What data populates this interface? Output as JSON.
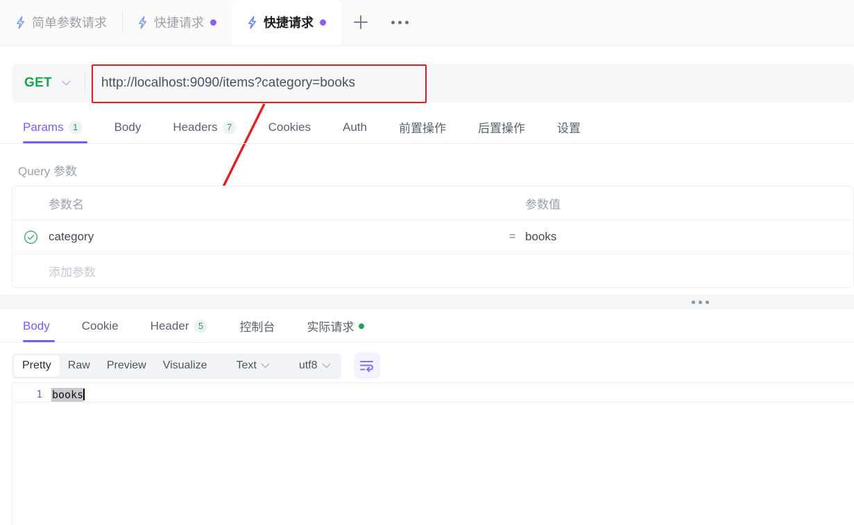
{
  "tabbar": {
    "tabs": [
      {
        "label": "简单参数请求",
        "icon": "lightning-icon",
        "active": false,
        "modified": false
      },
      {
        "label": "快捷请求",
        "icon": "lightning-icon",
        "active": false,
        "modified": true
      },
      {
        "label": "快捷请求",
        "icon": "lightning-icon",
        "active": true,
        "modified": true
      }
    ],
    "add_label": "+",
    "more_label": "•••"
  },
  "request": {
    "method": "GET",
    "url": "http://localhost:9090/items?category=books",
    "tabs": [
      {
        "label": "Params",
        "badge": "1",
        "active": true
      },
      {
        "label": "Body",
        "badge": "",
        "active": false
      },
      {
        "label": "Headers",
        "badge": "7",
        "active": false
      },
      {
        "label": "Cookies",
        "badge": "",
        "active": false
      },
      {
        "label": "Auth",
        "badge": "",
        "active": false
      },
      {
        "label": "前置操作",
        "badge": "",
        "active": false
      },
      {
        "label": "后置操作",
        "badge": "",
        "active": false
      },
      {
        "label": "设置",
        "badge": "",
        "active": false
      }
    ],
    "params_section_title": "Query 参数",
    "params_table": {
      "headers": {
        "name": "参数名",
        "value": "参数值"
      },
      "rows": [
        {
          "enabled": true,
          "name": "category",
          "eq": "=",
          "value": "books"
        }
      ],
      "add_row_placeholder": "添加参数"
    }
  },
  "response": {
    "tabs": [
      {
        "label": "Body",
        "badge": "",
        "active": true,
        "dot": false
      },
      {
        "label": "Cookie",
        "badge": "",
        "active": false,
        "dot": false
      },
      {
        "label": "Header",
        "badge": "5",
        "active": false,
        "dot": false
      },
      {
        "label": "控制台",
        "badge": "",
        "active": false,
        "dot": false
      },
      {
        "label": "实际请求",
        "badge": "",
        "active": false,
        "dot": true
      }
    ],
    "view_modes": [
      {
        "label": "Pretty",
        "active": true
      },
      {
        "label": "Raw",
        "active": false
      },
      {
        "label": "Preview",
        "active": false
      },
      {
        "label": "Visualize",
        "active": false
      }
    ],
    "format_select": "Text",
    "encoding_select": "utf8",
    "wrap_button_icon": "wrap-text-icon",
    "body": {
      "lines": [
        {
          "number": "1",
          "text": "books"
        }
      ]
    }
  },
  "annotation": {
    "highlight_box_color": "#e02020",
    "arrow_color": "#e02020"
  },
  "colors": {
    "accent_purple": "#7c5cf0",
    "method_green": "#16a34a",
    "badge_green": "#22a05c",
    "tab_dot_purple": "#8b5cf6"
  }
}
